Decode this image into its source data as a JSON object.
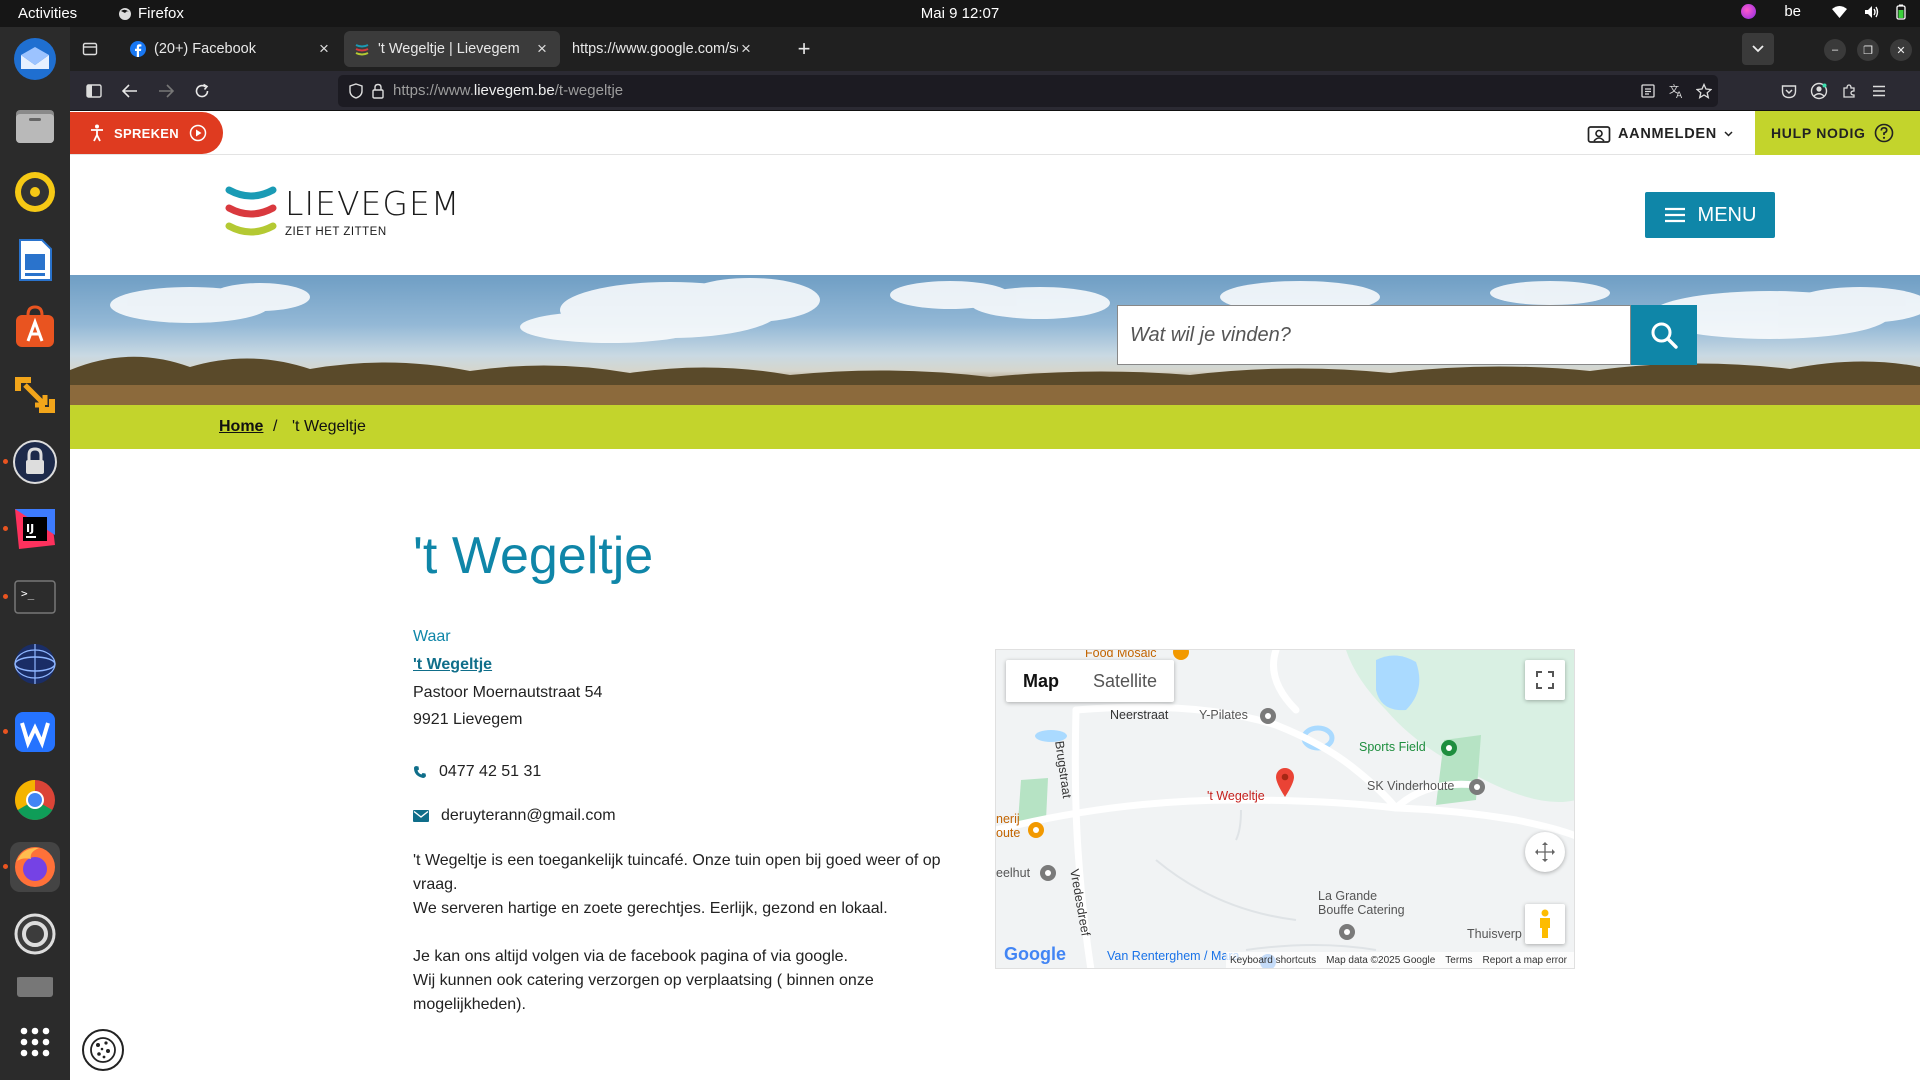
{
  "system": {
    "activities": "Activities",
    "app_name": "Firefox",
    "clock": "Mai 9  12:07",
    "keyboard_layout": "be"
  },
  "browser": {
    "tabs": [
      {
        "title": "(20+) Facebook",
        "active": false
      },
      {
        "title": "'t Wegeltje | Lievegem",
        "active": true
      },
      {
        "title": "https://www.google.com/se",
        "active": false
      }
    ],
    "url_prefix": "https://www.",
    "url_domain": "lievegem.be",
    "url_path": "/t-wegeltje"
  },
  "site": {
    "speak_label": "SPREKEN",
    "login_label": "AANMELDEN",
    "help_label": "HULP NODIG",
    "logo_word": "LIEVEGEM",
    "logo_tagline": "ZIET HET ZITTEN",
    "menu_label": "MENU",
    "search_placeholder": "Wat wil je vinden?",
    "breadcrumb": {
      "home": "Home",
      "separator": "/",
      "current": "'t Wegeltje"
    }
  },
  "content": {
    "title": "'t Wegeltje",
    "where_label": "Waar",
    "place_name": "'t Wegeltje",
    "street": "Pastoor Moernautstraat 54",
    "city": "9921 Lievegem",
    "phone": "0477 42 51 31",
    "email": "deruyterann@gmail.com",
    "description": [
      "'t Wegeltje is een toegankelijk tuincafé. Onze tuin open bij goed weer of op vraag.",
      "We serveren hartige en zoete gerechtjes. Eerlijk, gezond en lokaal.",
      "",
      "Je kan ons altijd volgen via de facebook pagina of via google.",
      "Wij kunnen ook catering verzorgen op verplaatsing ( binnen onze mogelijkheden)."
    ]
  },
  "map": {
    "type_map": "Map",
    "type_satellite": "Satellite",
    "labels": {
      "food_mosaic": "Food Mosaic",
      "neerstraat": "Neerstraat",
      "y_pilates": "Y-Pilates",
      "sports_field": "Sports Field",
      "sk_vinderhoute": "SK Vinderhoute",
      "brugstraat": "Brugstraat",
      "wegeltje": "'t Wegeltje",
      "nerij": "nerij",
      "oute": "oute",
      "eelhut": "eelhut",
      "vredesdreef": "Vredesdreef",
      "la_grande_1": "La Grande",
      "la_grande_2": "Bouffe Catering",
      "van_renterghem": "Van Renterghem / Mara",
      "thuisverp": "Thuisverp",
      "google": "Google"
    },
    "footer": {
      "shortcuts": "Keyboard shortcuts",
      "data": "Map data ©2025 Google",
      "terms": "Terms",
      "report": "Report a map error"
    }
  },
  "colors": {
    "brand_teal": "#0f86a8",
    "brand_lime": "#c3d42c",
    "speak_red": "#df3b20"
  }
}
